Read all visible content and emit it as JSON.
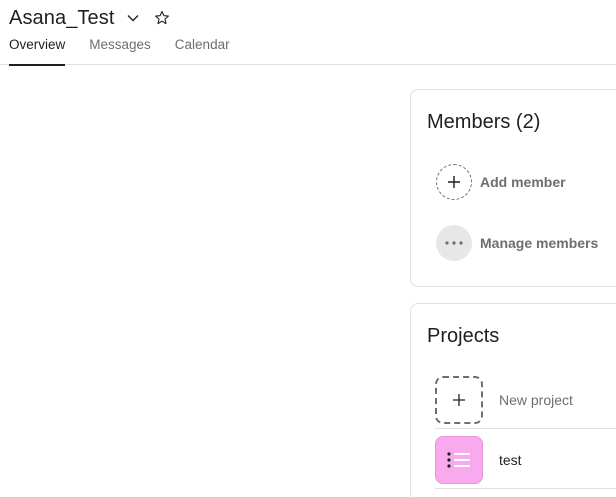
{
  "header": {
    "title": "Asana_Test",
    "tabs": [
      {
        "label": "Overview",
        "active": true
      },
      {
        "label": "Messages",
        "active": false
      },
      {
        "label": "Calendar",
        "active": false
      }
    ]
  },
  "members": {
    "title": "Members (2)",
    "add_label": "Add member",
    "manage_label": "Manage members"
  },
  "projects": {
    "title": "Projects",
    "new_label": "New project",
    "items": [
      {
        "name": "test",
        "color": "#f9aaef"
      }
    ]
  },
  "icons": {
    "title_dropdown": "chevron-down-icon",
    "favorite": "star-icon",
    "add_member": "plus-icon",
    "manage_members": "ellipsis-icon",
    "new_project": "plus-icon",
    "project": "list-icon"
  }
}
